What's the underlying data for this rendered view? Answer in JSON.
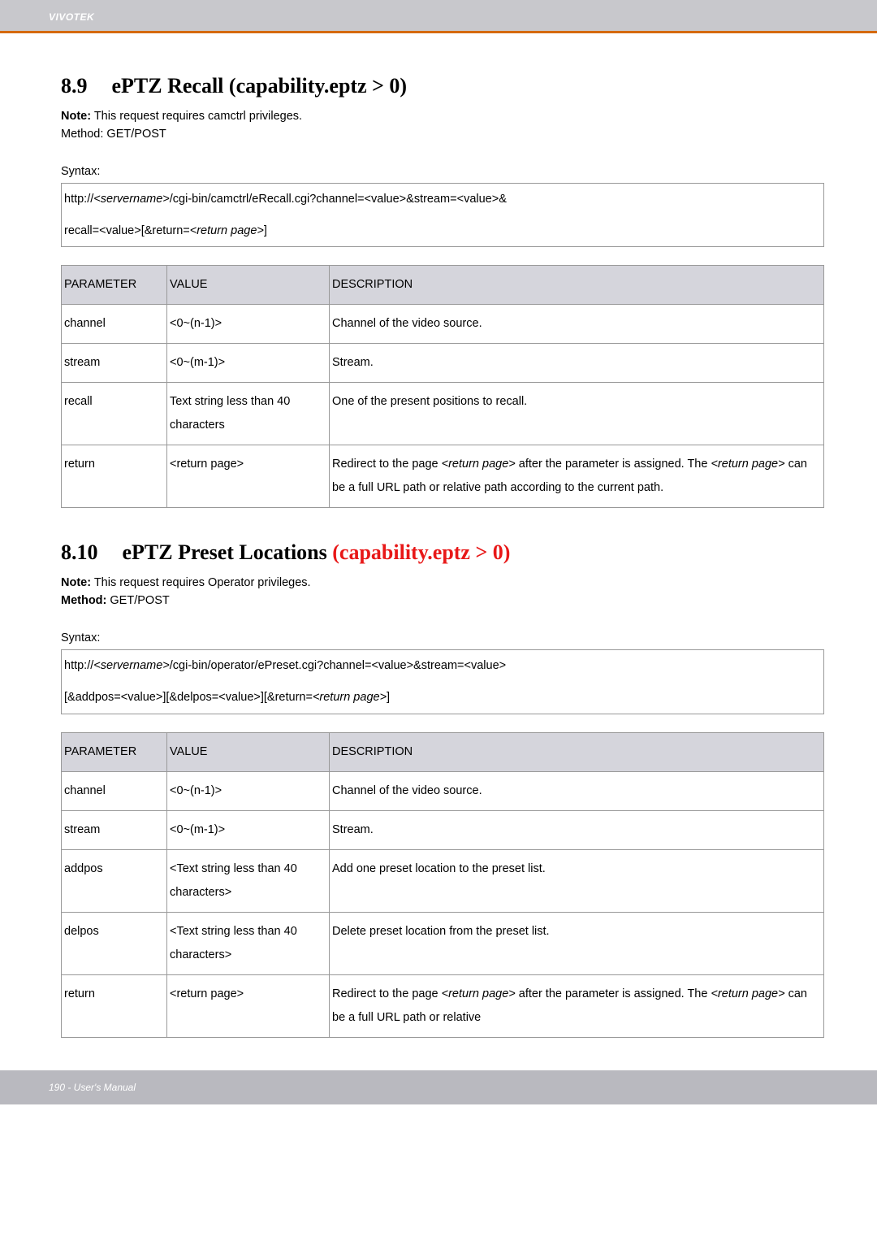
{
  "header": {
    "brand": "VIVOTEK"
  },
  "section89": {
    "number": "8.9",
    "title": "ePTZ Recall (capability.eptz > 0)",
    "note_label": "Note:",
    "note_text": " This request requires camctrl privileges.",
    "method_label": "Method:",
    "method_text": " GET/POST",
    "syntax_label": "Syntax:",
    "syntax_line1_pre": "http://",
    "syntax_line1_em": "<servername>",
    "syntax_line1_post": "/cgi-bin/camctrl/eRecall.cgi?channel=<value>&stream=<value>&",
    "syntax_line2_pre": "recall=<value>[&return=",
    "syntax_line2_em": "<return page>",
    "syntax_line2_post": "]",
    "table": {
      "headers": {
        "param": "PARAMETER",
        "value": "VALUE",
        "desc": "DESCRIPTION"
      },
      "rows": [
        {
          "param": "channel",
          "value": "<0~(n-1)>",
          "desc": "Channel of the video source."
        },
        {
          "param": "stream",
          "value": "<0~(m-1)>",
          "desc": "Stream."
        },
        {
          "param": "recall",
          "value": "Text string less than 40 characters",
          "desc": "One of the present positions to recall."
        },
        {
          "param": "return",
          "value": "<return page>",
          "desc_pre": "Redirect to the page ",
          "desc_em1": "<return page>",
          "desc_mid1": " after the parameter is assigned. The ",
          "desc_em2": "<return page>",
          "desc_post": " can be a full URL path or relative path according to the current path."
        }
      ]
    }
  },
  "section810": {
    "number": "8.10",
    "title_black": "ePTZ Preset Locations ",
    "title_red": "(capability.eptz > 0)",
    "note_label": "Note:",
    "note_text": " This request requires Operator privileges.",
    "method_label": "Method:",
    "method_text": " GET/POST",
    "syntax_label": "Syntax:",
    "syntax_line1_pre": "http://",
    "syntax_line1_em": "<servername>",
    "syntax_line1_post": "/cgi-bin/operator/ePreset.cgi?channel=<value>&stream=<value>",
    "syntax_line2_pre": "[&addpos=<value>][&delpos=<value>][&return=",
    "syntax_line2_em": "<return page>",
    "syntax_line2_post": "]",
    "table": {
      "headers": {
        "param": "PARAMETER",
        "value": "VALUE",
        "desc": "DESCRIPTION"
      },
      "rows": [
        {
          "param": "channel",
          "value": "<0~(n-1)>",
          "desc": "Channel of the video source."
        },
        {
          "param": "stream",
          "value": "<0~(m-1)>",
          "desc": "Stream."
        },
        {
          "param": "addpos",
          "value": "<Text string less than 40 characters>",
          "desc": "Add one preset location to the preset list."
        },
        {
          "param": "delpos",
          "value": "<Text string less than 40 characters>",
          "desc": "Delete preset location from the preset list."
        },
        {
          "param": "return",
          "value": "<return page>",
          "desc_pre": "Redirect to the page ",
          "desc_em1": "<return page>",
          "desc_mid1": " after the parameter is assigned. The ",
          "desc_em2": "<return page>",
          "desc_post": " can be a full URL path or relative"
        }
      ]
    }
  },
  "footer": {
    "text": "190 - User's Manual"
  }
}
